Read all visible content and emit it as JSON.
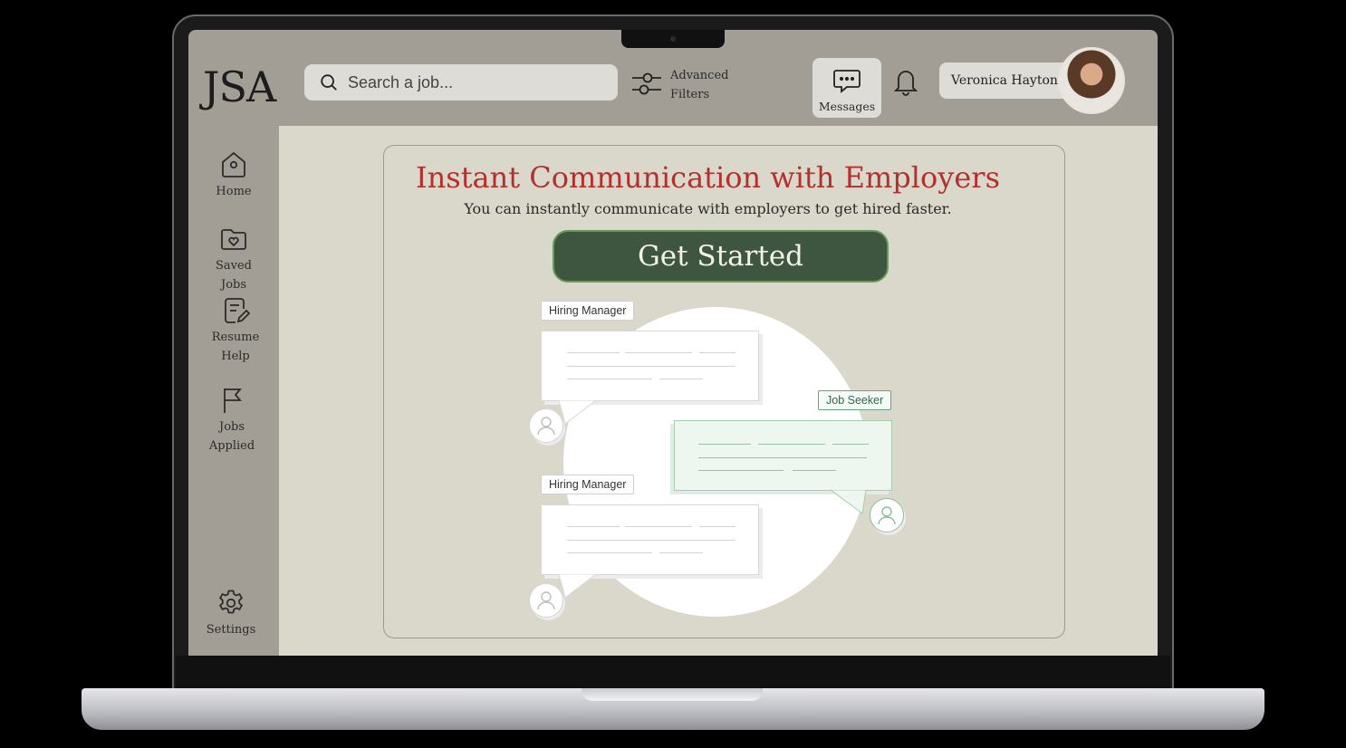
{
  "app": {
    "logo": "JSA"
  },
  "search": {
    "placeholder": "Search a job..."
  },
  "filters": {
    "line1": "Advanced",
    "line2": "Filters"
  },
  "header": {
    "messages_label": "Messages",
    "user_name": "Veronica Hayton"
  },
  "sidebar": {
    "items": [
      {
        "label": "Home"
      },
      {
        "label": "Saved Jobs"
      },
      {
        "label_line1": "Resume",
        "label_line2": "Help"
      },
      {
        "label_line1": "Jobs",
        "label_line2": "Applied"
      }
    ],
    "settings_label": "Settings"
  },
  "hero": {
    "title": "Instant Communication with Employers",
    "subtitle": "You can instantly communicate with employers to get hired faster.",
    "cta_label": "Get Started"
  },
  "illustration": {
    "tag_manager_1": "Hiring Manager",
    "tag_seeker": "Job Seeker",
    "tag_manager_2": "Hiring Manager"
  },
  "colors": {
    "accent_red": "#b52f2d",
    "cta_green": "#3e5640",
    "content_bg": "#dad8ca",
    "frame_bg": "#a29e96"
  }
}
